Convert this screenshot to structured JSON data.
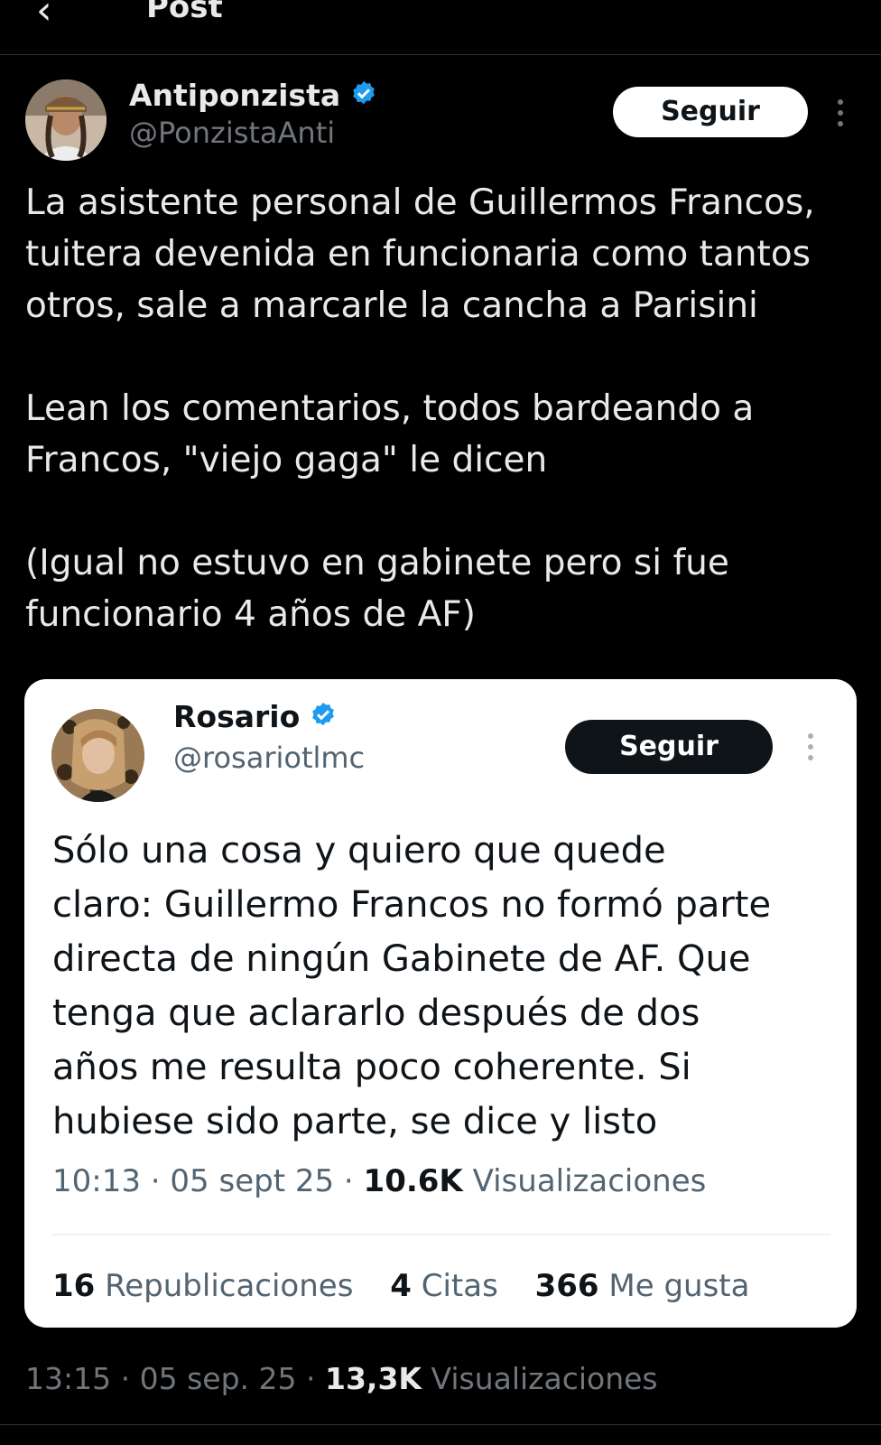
{
  "topbar": {
    "back_icon": "back-arrow-icon",
    "title": "Post"
  },
  "post": {
    "author": {
      "name": "Antiponzista",
      "handle": "@PonzistaAnti",
      "verified": true
    },
    "follow_label": "Seguir",
    "body": [
      "La asistente personal de Guillermos Francos,\ntuitera devenida en funcionaria como tantos\notros, sale a marcarle la cancha a Parisini",
      "Lean los comentarios, todos bardeando a\nFrancos, \"viejo gaga\" le dicen",
      "(Igual no estuvo en gabinete pero si fue\nfuncionario 4 años de AF)"
    ],
    "time": "13:15",
    "date": "05 sep. 25",
    "views_count": "13,3K",
    "views_label": "Visualizaciones"
  },
  "quoted": {
    "author": {
      "name": "Rosario",
      "handle": "@rosariotlmc",
      "verified": true
    },
    "follow_label": "Seguir",
    "text": "Sólo una cosa y quiero que quede\nclaro: Guillermo Francos no formó parte\ndirecta de ningún Gabinete de AF. Que\ntenga que aclararlo después de dos\naños me resulta poco coherente. Si\nhubiese sido parte, se dice y listo",
    "time": "10:13",
    "date": "05 sept 25",
    "views_count": "10.6K",
    "views_label": "Visualizaciones",
    "stats": {
      "reposts_count": "16",
      "reposts_label": "Republicaciones",
      "quotes_count": "4",
      "quotes_label": "Citas",
      "likes_count": "366",
      "likes_label": "Me gusta"
    }
  },
  "colors": {
    "verified": "#1d9bf0",
    "background": "#000000",
    "card": "#ffffff"
  }
}
